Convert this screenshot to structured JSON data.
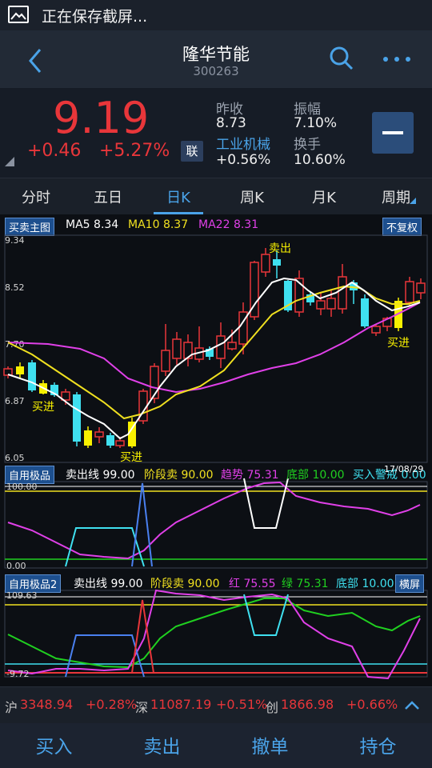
{
  "status": {
    "text": "正在保存截屏..."
  },
  "header": {
    "title": "隆华节能",
    "code": "300263"
  },
  "quote": {
    "price": "9.19",
    "change": "+0.46",
    "change_pct": "+5.27%",
    "lian_label": "联",
    "prev_close_label": "昨收",
    "prev_close": "8.73",
    "amplitude_label": "振幅",
    "amplitude": "7.10%",
    "sector_label": "工业机械",
    "sector_change": "+0.56%",
    "turnover_label": "换手",
    "turnover": "10.60%"
  },
  "tabs": [
    {
      "label": "分时"
    },
    {
      "label": "五日"
    },
    {
      "label": "日K"
    },
    {
      "label": "周K"
    },
    {
      "label": "月K"
    },
    {
      "label": "周期"
    }
  ],
  "active_tab": "日K",
  "main_chart": {
    "badge": "买卖主图",
    "ma5_label": "MA5",
    "ma5": "8.34",
    "ma10_label": "MA10",
    "ma10": "8.37",
    "ma22_label": "MA22",
    "ma22": "8.31",
    "adjust_badge": "不复权",
    "y_ticks": [
      "9.34",
      "8.52",
      "7.70",
      "6.87",
      "6.05"
    ],
    "annotations": {
      "buy1": "买进",
      "buy2": "买进",
      "sell": "卖出",
      "buy3": "买进"
    },
    "colors": {
      "up": "#e8363a",
      "down": "#3fe0f0",
      "ma5": "#ffffff",
      "ma10": "#f0e020",
      "ma22": "#e040e8",
      "signal": "#f8f000"
    }
  },
  "sub1": {
    "badge": "自用极品",
    "sell_line_label": "卖出线",
    "sell_line": "99.00",
    "stage_sell_label": "阶段卖",
    "stage_sell": "90.00",
    "trend_label": "趋势",
    "trend": "75.31",
    "bottom_label": "底部",
    "bottom": "10.00",
    "buy_warn_label": "买入警戒",
    "buy_warn": "0.00",
    "date": "17/08/29",
    "y_top": "100.00",
    "y_bottom": "0.00"
  },
  "sub2": {
    "badge": "自用极品2",
    "sell_line_label": "卖出线",
    "sell_line": "99.00",
    "stage_sell_label": "阶段卖",
    "stage_sell": "90.00",
    "red_label": "红",
    "red": "75.55",
    "green_label": "绿",
    "green": "75.31",
    "bottom_label": "底部",
    "bottom": "10.00",
    "landscape_badge": "横屏",
    "y_top": "109.63",
    "y_bottom": "-9.72"
  },
  "index_bar": {
    "sh_label": "沪",
    "sh": "3348.94",
    "sh_pct": "+0.28%",
    "sz_label": "深",
    "sz": "11087.19",
    "sz_pct": "+0.51%",
    "cy_label": "创",
    "cy": "1866.98",
    "cy_pct": "+0.66%"
  },
  "actions": {
    "buy": "买入",
    "sell": "卖出",
    "cancel": "撤单",
    "position": "持仓"
  }
}
